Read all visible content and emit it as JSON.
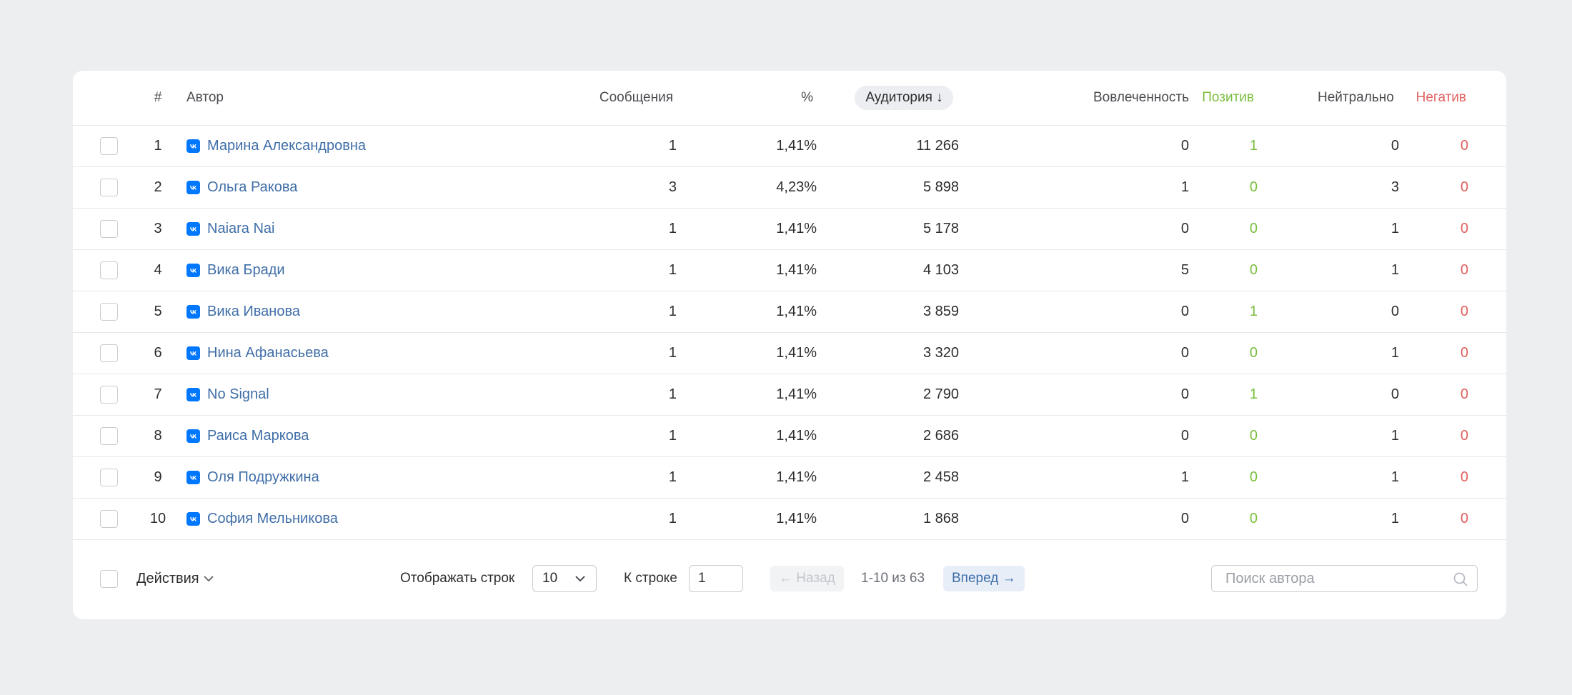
{
  "columns": {
    "num": "#",
    "author": "Автор",
    "messages": "Сообщения",
    "percent": "%",
    "audience": "Аудитория ↓",
    "engagement": "Вовлеченность",
    "positive": "Позитив",
    "neutral": "Нейтрально",
    "negative": "Негатив"
  },
  "rows": [
    {
      "num": "1",
      "author": "Марина Александровна",
      "messages": "1",
      "percent": "1,41%",
      "audience": "11 266",
      "engagement": "0",
      "positive": "1",
      "neutral": "0",
      "negative": "0"
    },
    {
      "num": "2",
      "author": "Ольга Ракова",
      "messages": "3",
      "percent": "4,23%",
      "audience": "5 898",
      "engagement": "1",
      "positive": "0",
      "neutral": "3",
      "negative": "0"
    },
    {
      "num": "3",
      "author": "Naiara Nai",
      "messages": "1",
      "percent": "1,41%",
      "audience": "5 178",
      "engagement": "0",
      "positive": "0",
      "neutral": "1",
      "negative": "0"
    },
    {
      "num": "4",
      "author": "Вика Бради",
      "messages": "1",
      "percent": "1,41%",
      "audience": "4 103",
      "engagement": "5",
      "positive": "0",
      "neutral": "1",
      "negative": "0"
    },
    {
      "num": "5",
      "author": "Вика Иванова",
      "messages": "1",
      "percent": "1,41%",
      "audience": "3 859",
      "engagement": "0",
      "positive": "1",
      "neutral": "0",
      "negative": "0"
    },
    {
      "num": "6",
      "author": "Нина Афанасьева",
      "messages": "1",
      "percent": "1,41%",
      "audience": "3 320",
      "engagement": "0",
      "positive": "0",
      "neutral": "1",
      "negative": "0"
    },
    {
      "num": "7",
      "author": "No Signal",
      "messages": "1",
      "percent": "1,41%",
      "audience": "2 790",
      "engagement": "0",
      "positive": "1",
      "neutral": "0",
      "negative": "0"
    },
    {
      "num": "8",
      "author": "Раиса Маркова",
      "messages": "1",
      "percent": "1,41%",
      "audience": "2 686",
      "engagement": "0",
      "positive": "0",
      "neutral": "1",
      "negative": "0"
    },
    {
      "num": "9",
      "author": "Оля Подружкина",
      "messages": "1",
      "percent": "1,41%",
      "audience": "2 458",
      "engagement": "1",
      "positive": "0",
      "neutral": "1",
      "negative": "0"
    },
    {
      "num": "10",
      "author": "София Мельникова",
      "messages": "1",
      "percent": "1,41%",
      "audience": "1 868",
      "engagement": "0",
      "positive": "0",
      "neutral": "1",
      "negative": "0"
    }
  ],
  "footer": {
    "actions_label": "Действия",
    "rows_per_page_label": "Отображать строк",
    "rows_per_page_value": "10",
    "goto_row_label": "К строке",
    "goto_row_value": "1",
    "prev_label": "← Назад",
    "range_label": "1-10 из 63",
    "next_label": "Вперед →",
    "search_placeholder": "Поиск автора"
  },
  "colors": {
    "positive": "#7bbf3f",
    "negative": "#e0605e",
    "link": "#3f6ea8",
    "vk_brand": "#0077ff"
  },
  "icons": {
    "source": "vk-icon",
    "dropdown": "chevron-down-icon",
    "search": "search-icon"
  }
}
